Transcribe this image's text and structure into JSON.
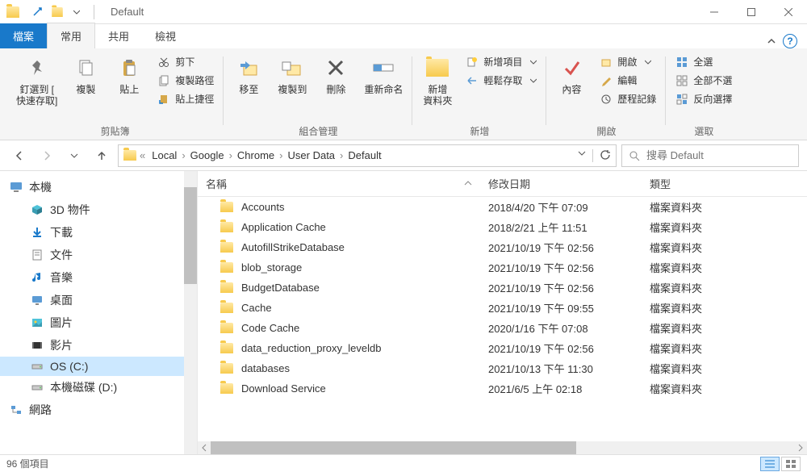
{
  "title": "Default",
  "tabs": {
    "file": "檔案",
    "home": "常用",
    "share": "共用",
    "view": "檢視"
  },
  "ribbon": {
    "pin": "釘選到 [\n快速存取]",
    "copy": "複製",
    "paste": "貼上",
    "cut": "剪下",
    "copypath": "複製路徑",
    "pasteshort": "貼上捷徑",
    "clipboard_label": "剪貼簿",
    "moveto": "移至",
    "copyto": "複製到",
    "delete": "刪除",
    "rename": "重新命名",
    "organize_label": "組合管理",
    "newfolder": "新增\n資料夾",
    "newitem": "新增項目",
    "easyaccess": "輕鬆存取",
    "new_label": "新增",
    "properties": "內容",
    "open": "開啟",
    "edit": "編輯",
    "history": "歷程記錄",
    "open_label": "開啟",
    "selectall": "全選",
    "selectnone": "全部不選",
    "invert": "反向選擇",
    "select_label": "選取"
  },
  "breadcrumbs": [
    "Local",
    "Google",
    "Chrome",
    "User Data",
    "Default"
  ],
  "search_placeholder": "搜尋 Default",
  "sidebar": {
    "thispc": "本機",
    "items": [
      {
        "label": "3D 物件",
        "icon": "cube"
      },
      {
        "label": "下載",
        "icon": "download"
      },
      {
        "label": "文件",
        "icon": "doc"
      },
      {
        "label": "音樂",
        "icon": "music"
      },
      {
        "label": "桌面",
        "icon": "desktop"
      },
      {
        "label": "圖片",
        "icon": "pic"
      },
      {
        "label": "影片",
        "icon": "video"
      },
      {
        "label": "OS (C:)",
        "icon": "drive",
        "selected": true
      },
      {
        "label": "本機磁碟 (D:)",
        "icon": "drive"
      }
    ],
    "network": "網路"
  },
  "columns": {
    "name": "名稱",
    "date": "修改日期",
    "type": "類型"
  },
  "rows": [
    {
      "name": "Accounts",
      "date": "2018/4/20 下午 07:09",
      "type": "檔案資料夾"
    },
    {
      "name": "Application Cache",
      "date": "2018/2/21 上午 11:51",
      "type": "檔案資料夾"
    },
    {
      "name": "AutofillStrikeDatabase",
      "date": "2021/10/19 下午 02:56",
      "type": "檔案資料夾"
    },
    {
      "name": "blob_storage",
      "date": "2021/10/19 下午 02:56",
      "type": "檔案資料夾"
    },
    {
      "name": "BudgetDatabase",
      "date": "2021/10/19 下午 02:56",
      "type": "檔案資料夾"
    },
    {
      "name": "Cache",
      "date": "2021/10/19 下午 09:55",
      "type": "檔案資料夾"
    },
    {
      "name": "Code Cache",
      "date": "2020/1/16 下午 07:08",
      "type": "檔案資料夾"
    },
    {
      "name": "data_reduction_proxy_leveldb",
      "date": "2021/10/19 下午 02:56",
      "type": "檔案資料夾"
    },
    {
      "name": "databases",
      "date": "2021/10/13 下午 11:30",
      "type": "檔案資料夾"
    },
    {
      "name": "Download Service",
      "date": "2021/6/5 上午 02:18",
      "type": "檔案資料夾"
    }
  ],
  "status": "96 個項目"
}
